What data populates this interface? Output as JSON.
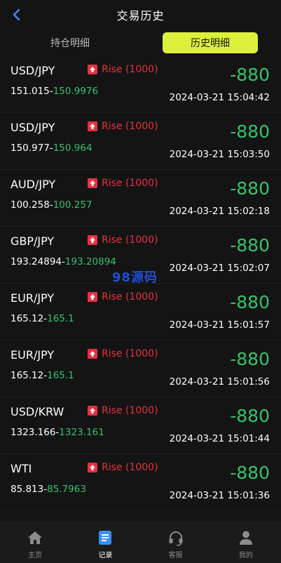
{
  "header": {
    "title": "交易历史"
  },
  "tabs": [
    {
      "label": "持仓明细"
    },
    {
      "label": "历史明细"
    }
  ],
  "colors": {
    "accent": "#dcf03c",
    "rise": "#e8313f",
    "profit_green": "#36c26b",
    "background": "#141414"
  },
  "records": [
    {
      "pair": "USD/JPY",
      "direction": "Rise (1000)",
      "open": "151.015",
      "close": "150.9976",
      "pnl": "-880",
      "time": "2024-03-21 15:04:42"
    },
    {
      "pair": "USD/JPY",
      "direction": "Rise (1000)",
      "open": "150.977",
      "close": "150.964",
      "pnl": "-880",
      "time": "2024-03-21 15:03:50"
    },
    {
      "pair": "AUD/JPY",
      "direction": "Rise (1000)",
      "open": "100.258",
      "close": "100.257",
      "pnl": "-880",
      "time": "2024-03-21 15:02:18"
    },
    {
      "pair": "GBP/JPY",
      "direction": "Rise (1000)",
      "open": "193.24894",
      "close": "193.20894",
      "pnl": "-880",
      "time": "2024-03-21 15:02:07"
    },
    {
      "pair": "EUR/JPY",
      "direction": "Rise (1000)",
      "open": "165.12",
      "close": "165.1",
      "pnl": "-880",
      "time": "2024-03-21 15:01:57"
    },
    {
      "pair": "EUR/JPY",
      "direction": "Rise (1000)",
      "open": "165.12",
      "close": "165.1",
      "pnl": "-880",
      "time": "2024-03-21 15:01:56"
    },
    {
      "pair": "USD/KRW",
      "direction": "Rise (1000)",
      "open": "1323.166",
      "close": "1323.161",
      "pnl": "-880",
      "time": "2024-03-21 15:01:44"
    },
    {
      "pair": "WTI",
      "direction": "Rise (1000)",
      "open": "85.813",
      "close": "85.7963",
      "pnl": "-880",
      "time": "2024-03-21 15:01:36"
    }
  ],
  "watermark": "98源码",
  "nav": [
    {
      "label": "主页",
      "icon": "home-icon"
    },
    {
      "label": "记录",
      "icon": "records-icon"
    },
    {
      "label": "客服",
      "icon": "headset-icon"
    },
    {
      "label": "我的",
      "icon": "user-icon"
    }
  ]
}
